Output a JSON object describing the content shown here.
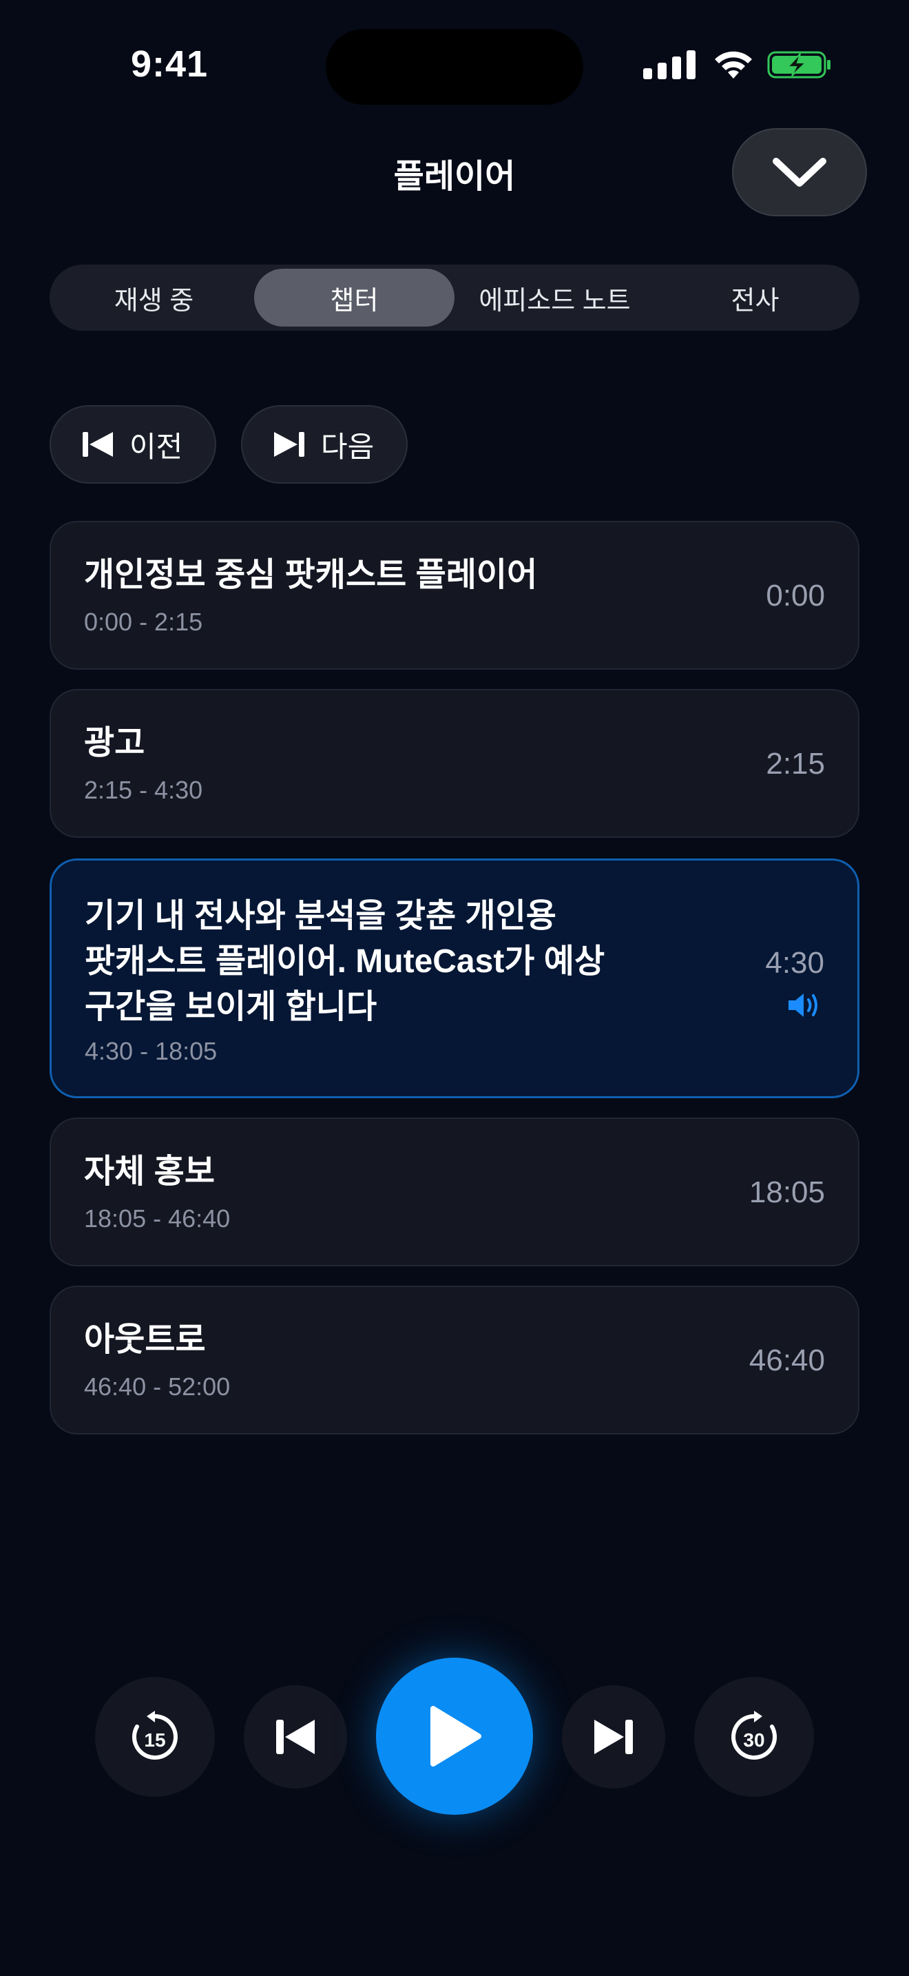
{
  "status": {
    "time": "9:41"
  },
  "header": {
    "title": "플레이어"
  },
  "tabs": [
    {
      "label": "재생 중",
      "active": false
    },
    {
      "label": "챕터",
      "active": true
    },
    {
      "label": "에피소드 노트",
      "active": false
    },
    {
      "label": "전사",
      "active": false
    }
  ],
  "nav": {
    "prev_label": "이전",
    "next_label": "다음"
  },
  "chapters": [
    {
      "title": "개인정보 중심 팟캐스트 플레이어",
      "range": "0:00 - 2:15",
      "start": "0:00"
    },
    {
      "title": "광고",
      "range": "2:15 - 4:30",
      "start": "2:15"
    },
    {
      "title_lines": [
        "기기 내 전사와 분석을 갖춘 개인용",
        "팟캐스트 플레이어. MuteCast가 예상",
        "구간을 보이게 합니다"
      ],
      "range": "4:30 - 18:05",
      "start": "4:30",
      "playing": true
    },
    {
      "title": "자체 홍보",
      "range": "18:05 - 46:40",
      "start": "18:05"
    },
    {
      "title": "아웃트로",
      "range": "46:40 - 52:00",
      "start": "46:40"
    }
  ],
  "controls": {
    "skip_back_seconds": "15",
    "skip_forward_seconds": "30"
  },
  "colors": {
    "background": "#050a16",
    "accent": "#0a8cf5",
    "active_card": "#051734",
    "battery": "#34c759"
  }
}
